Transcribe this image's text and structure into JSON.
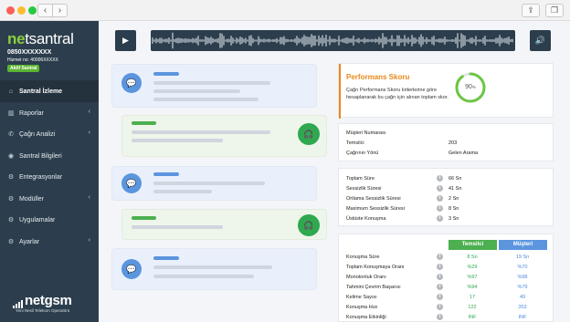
{
  "browser": {
    "back": "‹",
    "forward": "›",
    "share_icon": "share-icon",
    "tabs_icon": "tabs-icon"
  },
  "sidebar": {
    "logo_pre": "n",
    "logo_o": "e",
    "logo_post": "tsantral",
    "phone": "0850XXXXXXX",
    "account": "Hizmet no: 40006XXXXX",
    "badge": "Aktif Santral",
    "items": [
      {
        "label": "Santral İzleme",
        "icon": "home-icon",
        "glyph": "⌂",
        "chevron": ""
      },
      {
        "label": "Raporlar",
        "icon": "chart-icon",
        "glyph": "▥",
        "chevron": "‹"
      },
      {
        "label": "Çağrı Analizi",
        "icon": "phone-icon",
        "glyph": "✆",
        "chevron": "‹"
      },
      {
        "label": "Santral Bilgileri",
        "icon": "info-icon",
        "glyph": "◉",
        "chevron": ""
      },
      {
        "label": "Entegrasyonlar",
        "icon": "integration-icon",
        "glyph": "⚙",
        "chevron": ""
      },
      {
        "label": "Modüller",
        "icon": "modules-icon",
        "glyph": "⚙",
        "chevron": "‹"
      },
      {
        "label": "Uygulamalar",
        "icon": "apps-icon",
        "glyph": "⚙",
        "chevron": ""
      },
      {
        "label": "Ayarlar",
        "icon": "settings-icon",
        "glyph": "⚙",
        "chevron": "‹"
      }
    ],
    "footer_logo": "netgsm",
    "footer_tagline": "Yeni Nesil Telekom Operatörü"
  },
  "player": {
    "play_icon": "▶",
    "volume_icon": "🔊"
  },
  "performance": {
    "title": "Performans Skoru",
    "description": "Çağrı Performans Skoru kriterlerine göre hesaplanarak bu çağrı için alınan toplam skor.",
    "score": "90",
    "score_unit": "%",
    "score_fraction": 0.9
  },
  "call_info": [
    {
      "label": "Müşteri Numarası",
      "value": ""
    },
    {
      "label": "Temsilci",
      "value": "203"
    },
    {
      "label": "Çağrının Yönü",
      "value": "Gelen Arama"
    }
  ],
  "durations": [
    {
      "label": "Toplam Süre",
      "value": "66 Sn"
    },
    {
      "label": "Sessizlik Süresi",
      "value": "41 Sn"
    },
    {
      "label": "Ortlama Sessizlik Süresi",
      "value": "2 Sn"
    },
    {
      "label": "Maximum Sessizlik Süresi",
      "value": "8 Sn"
    },
    {
      "label": "Üstüste Konuşma",
      "value": "3 Sn"
    }
  ],
  "comparison": {
    "col_agent": "Temsilci",
    "col_customer": "Müşteri",
    "rows": [
      {
        "label": "Konuşma Süre",
        "agent": "8 Sn",
        "customer": "19 Sn"
      },
      {
        "label": "Toplam Konuşmaya Oranı",
        "agent": "%29",
        "customer": "%70"
      },
      {
        "label": "Monotonluk Oranı",
        "agent": "%97",
        "customer": "%98"
      },
      {
        "label": "Tahmini Çevrim Başarısı",
        "agent": "%94",
        "customer": "%79"
      },
      {
        "label": "Kelime Sayısı",
        "agent": "17",
        "customer": "49"
      },
      {
        "label": "Konuşma Hızı",
        "agent": "122",
        "customer": "353"
      },
      {
        "label": "Konuşma Etkinliği",
        "agent": "INF",
        "customer": "INF"
      }
    ]
  },
  "colors": {
    "accent_orange": "#e8891c",
    "agent_green": "#5cb531",
    "customer_blue": "#5b95de",
    "sidebar": "#2c3e4d"
  }
}
